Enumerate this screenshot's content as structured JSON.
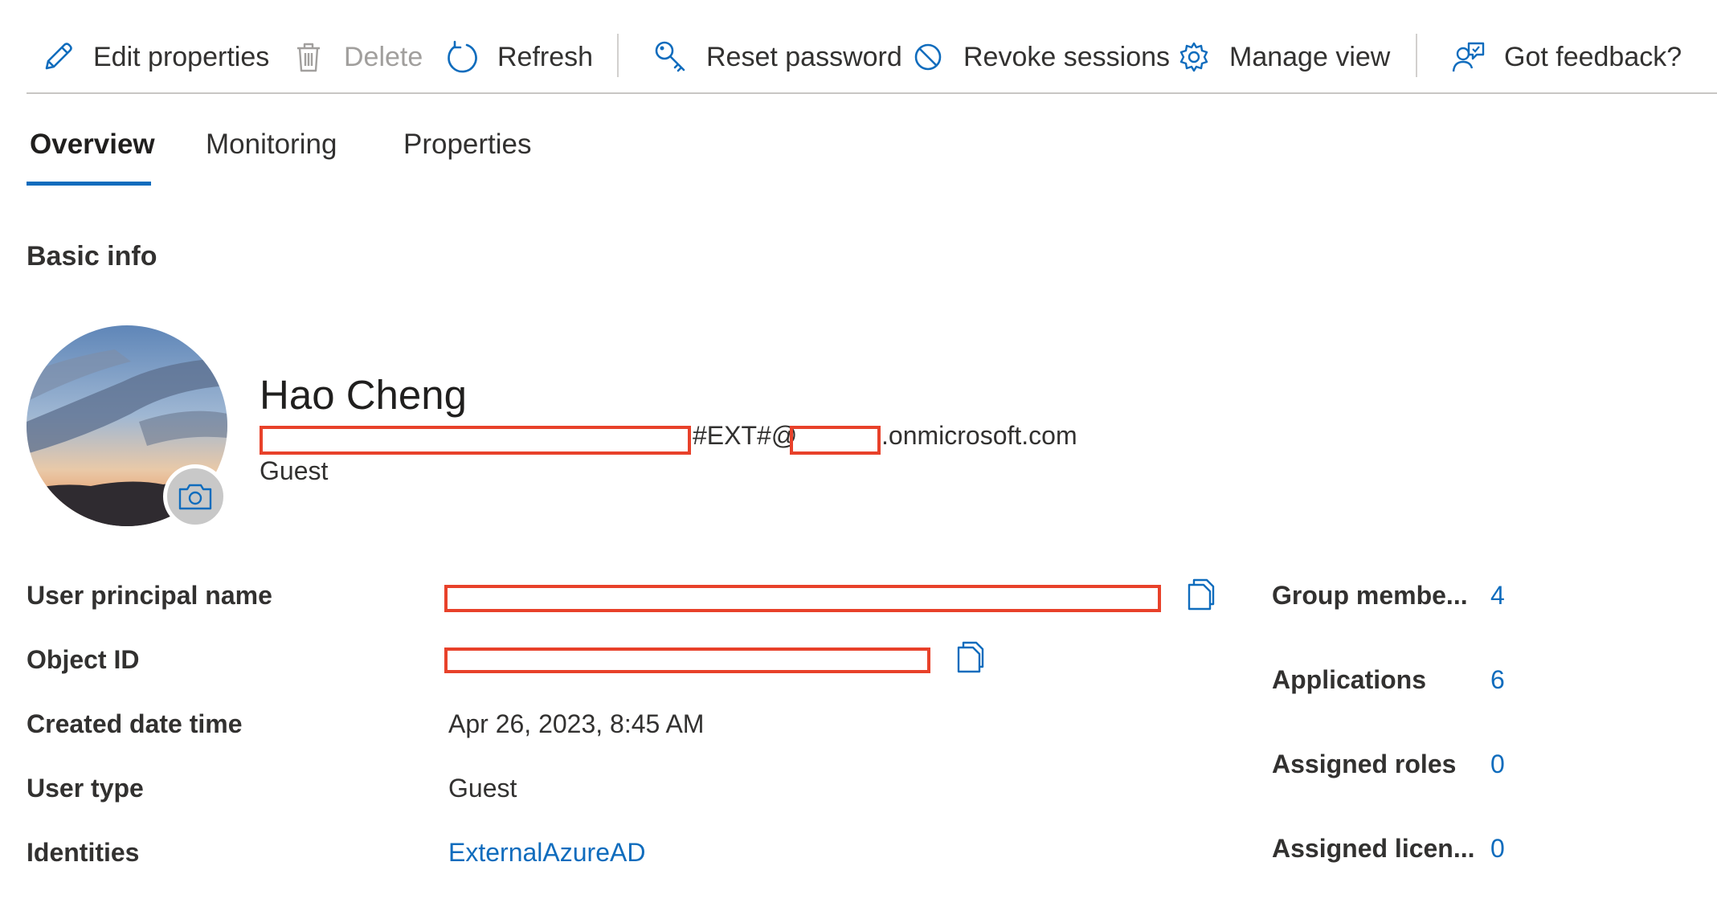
{
  "toolbar": {
    "edit_properties": "Edit properties",
    "delete": "Delete",
    "refresh": "Refresh",
    "reset_password": "Reset password",
    "revoke_sessions": "Revoke sessions",
    "manage_view": "Manage view",
    "got_feedback": "Got feedback?"
  },
  "tabs": [
    {
      "label": "Overview",
      "selected": true
    },
    {
      "label": "Monitoring",
      "selected": false
    },
    {
      "label": "Properties",
      "selected": false
    }
  ],
  "section_title": "Basic info",
  "profile": {
    "display_name": "Hao Cheng",
    "upn_middle": "#EXT#@",
    "upn_suffix": ".onmicrosoft.com",
    "user_type": "Guest"
  },
  "properties": [
    {
      "label": "User principal name",
      "value": ""
    },
    {
      "label": "Object ID",
      "value": ""
    },
    {
      "label": "Created date time",
      "value": "Apr 26, 2023, 8:45 AM"
    },
    {
      "label": "User type",
      "value": "Guest"
    },
    {
      "label": "Identities",
      "value": "ExternalAzureAD"
    }
  ],
  "stats": [
    {
      "label": "Group membe...",
      "value": "4"
    },
    {
      "label": "Applications",
      "value": "6"
    },
    {
      "label": "Assigned roles",
      "value": "0"
    },
    {
      "label": "Assigned licen...",
      "value": "0"
    }
  ],
  "colors": {
    "accent": "#0f6cbd",
    "redaction": "#e8412a",
    "text": "#323130",
    "disabled": "#a19f9d"
  },
  "icons": [
    "pencil-icon",
    "trash-icon",
    "refresh-icon",
    "key-icon",
    "block-icon",
    "gear-icon",
    "feedback-icon",
    "camera-icon",
    "copy-icon"
  ]
}
